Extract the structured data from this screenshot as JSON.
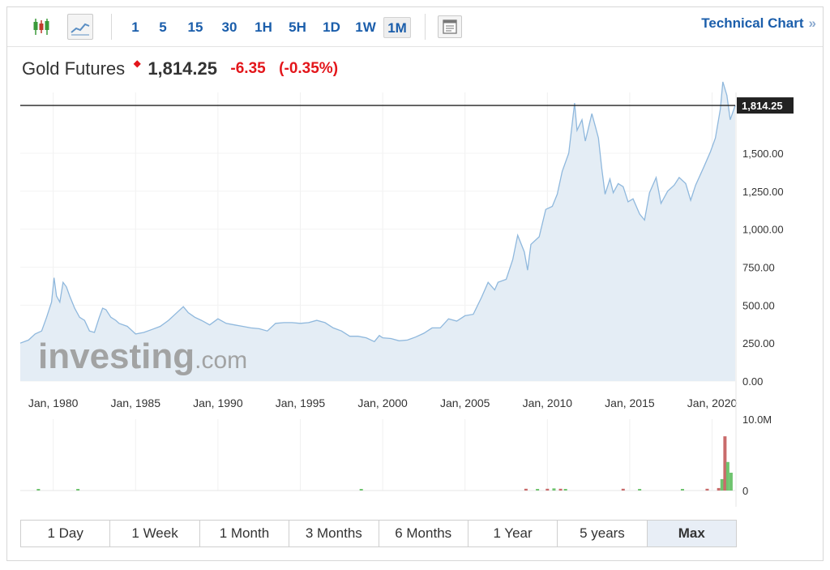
{
  "toolbar": {
    "chart_type_icons": [
      "candlestick-icon",
      "line-chart-icon"
    ],
    "intervals": [
      "1",
      "5",
      "15",
      "30",
      "1H",
      "5H",
      "1D",
      "1W",
      "1M"
    ],
    "active_interval": "1M",
    "settings_icon": "chart-settings-icon",
    "technical_chart_label": "Technical Chart",
    "technical_chart_chevron": "»"
  },
  "quote": {
    "name": "Gold Futures",
    "direction_icon": "down-arrow-icon",
    "price": "1,814.25",
    "change": "-6.35",
    "change_pct": "(-0.35%)"
  },
  "colors": {
    "accent": "#1b5eab",
    "negative": "#e3161b",
    "line": "#8fb8dd",
    "area": "#e4edf5",
    "volume_up": "#6fc46f",
    "volume_down": "#c96b6b"
  },
  "watermark": {
    "main": "investing",
    "suffix": ".com"
  },
  "range_buttons": [
    "1 Day",
    "1 Week",
    "1 Month",
    "3 Months",
    "6 Months",
    "1 Year",
    "5 years",
    "Max"
  ],
  "active_range": "Max",
  "chart_data": {
    "type": "area",
    "series": [
      {
        "values": [
          [
            1978.0,
            250
          ],
          [
            1978.5,
            270
          ],
          [
            1978.9,
            310
          ],
          [
            1979.3,
            330
          ],
          [
            1979.6,
            420
          ],
          [
            1979.9,
            520
          ],
          [
            1980.05,
            680
          ],
          [
            1980.2,
            560
          ],
          [
            1980.4,
            520
          ],
          [
            1980.6,
            650
          ],
          [
            1980.8,
            620
          ],
          [
            1981.0,
            560
          ],
          [
            1981.3,
            480
          ],
          [
            1981.6,
            420
          ],
          [
            1981.9,
            400
          ],
          [
            1982.2,
            330
          ],
          [
            1982.5,
            320
          ],
          [
            1982.8,
            420
          ],
          [
            1983.0,
            480
          ],
          [
            1983.2,
            470
          ],
          [
            1983.5,
            420
          ],
          [
            1983.8,
            400
          ],
          [
            1984.0,
            380
          ],
          [
            1984.5,
            360
          ],
          [
            1985.0,
            310
          ],
          [
            1985.5,
            320
          ],
          [
            1986.0,
            340
          ],
          [
            1986.5,
            360
          ],
          [
            1987.0,
            400
          ],
          [
            1987.5,
            450
          ],
          [
            1987.9,
            490
          ],
          [
            1988.2,
            450
          ],
          [
            1988.6,
            420
          ],
          [
            1989.0,
            400
          ],
          [
            1989.5,
            370
          ],
          [
            1990.0,
            410
          ],
          [
            1990.5,
            380
          ],
          [
            1991.0,
            370
          ],
          [
            1991.5,
            360
          ],
          [
            1992.0,
            350
          ],
          [
            1992.5,
            345
          ],
          [
            1993.0,
            330
          ],
          [
            1993.5,
            380
          ],
          [
            1994.0,
            385
          ],
          [
            1994.5,
            385
          ],
          [
            1995.0,
            380
          ],
          [
            1995.5,
            385
          ],
          [
            1996.0,
            400
          ],
          [
            1996.5,
            385
          ],
          [
            1997.0,
            350
          ],
          [
            1997.5,
            330
          ],
          [
            1998.0,
            295
          ],
          [
            1998.5,
            295
          ],
          [
            1999.0,
            285
          ],
          [
            1999.5,
            260
          ],
          [
            1999.8,
            300
          ],
          [
            2000.0,
            285
          ],
          [
            2000.5,
            280
          ],
          [
            2001.0,
            265
          ],
          [
            2001.5,
            270
          ],
          [
            2002.0,
            290
          ],
          [
            2002.5,
            315
          ],
          [
            2003.0,
            350
          ],
          [
            2003.5,
            350
          ],
          [
            2004.0,
            410
          ],
          [
            2004.5,
            395
          ],
          [
            2005.0,
            430
          ],
          [
            2005.5,
            440
          ],
          [
            2006.0,
            550
          ],
          [
            2006.4,
            650
          ],
          [
            2006.8,
            600
          ],
          [
            2007.0,
            650
          ],
          [
            2007.5,
            670
          ],
          [
            2007.9,
            800
          ],
          [
            2008.2,
            960
          ],
          [
            2008.6,
            850
          ],
          [
            2008.8,
            730
          ],
          [
            2009.0,
            900
          ],
          [
            2009.5,
            950
          ],
          [
            2009.9,
            1130
          ],
          [
            2010.3,
            1150
          ],
          [
            2010.6,
            1230
          ],
          [
            2010.9,
            1380
          ],
          [
            2011.3,
            1500
          ],
          [
            2011.65,
            1830
          ],
          [
            2011.8,
            1650
          ],
          [
            2012.1,
            1720
          ],
          [
            2012.3,
            1580
          ],
          [
            2012.7,
            1760
          ],
          [
            2012.9,
            1680
          ],
          [
            2013.1,
            1600
          ],
          [
            2013.3,
            1400
          ],
          [
            2013.5,
            1230
          ],
          [
            2013.8,
            1330
          ],
          [
            2014.0,
            1240
          ],
          [
            2014.3,
            1300
          ],
          [
            2014.6,
            1280
          ],
          [
            2014.9,
            1180
          ],
          [
            2015.2,
            1200
          ],
          [
            2015.6,
            1100
          ],
          [
            2015.9,
            1060
          ],
          [
            2016.2,
            1240
          ],
          [
            2016.6,
            1340
          ],
          [
            2016.9,
            1170
          ],
          [
            2017.3,
            1250
          ],
          [
            2017.7,
            1290
          ],
          [
            2018.0,
            1340
          ],
          [
            2018.4,
            1300
          ],
          [
            2018.7,
            1190
          ],
          [
            2019.0,
            1290
          ],
          [
            2019.5,
            1410
          ],
          [
            2019.9,
            1510
          ],
          [
            2020.2,
            1600
          ],
          [
            2020.5,
            1790
          ],
          [
            2020.65,
            1970
          ],
          [
            2020.9,
            1880
          ],
          [
            2021.1,
            1720
          ],
          [
            2021.4,
            1814.25
          ]
        ]
      }
    ],
    "last_value_label": "1,814.25",
    "ylim": [
      0,
      1900
    ],
    "y_ticks": [
      "1,500.00",
      "1,250.00",
      "1,000.00",
      "750.00",
      "500.00",
      "250.00",
      "0.00"
    ],
    "y_tick_values": [
      1500,
      1250,
      1000,
      750,
      500,
      250,
      0
    ],
    "x_ticks": [
      "Jan, 1980",
      "Jan, 1985",
      "Jan, 1990",
      "Jan, 1995",
      "Jan, 2000",
      "Jan, 2005",
      "Jan, 2010",
      "Jan, 2015",
      "Jan, 2020"
    ],
    "x_tick_values": [
      1980,
      1985,
      1990,
      1995,
      2000,
      2005,
      2010,
      2015,
      2020
    ],
    "xlim": [
      1978.0,
      2021.4
    ],
    "volume": {
      "y_ticks": [
        "10.0M",
        "0"
      ],
      "y_tick_values": [
        10000000,
        0
      ],
      "bars": [
        {
          "x": 1979.1,
          "v": 200000,
          "dir": "up"
        },
        {
          "x": 1981.5,
          "v": 200000,
          "dir": "up"
        },
        {
          "x": 1998.7,
          "v": 200000,
          "dir": "up"
        },
        {
          "x": 2008.7,
          "v": 250000,
          "dir": "down"
        },
        {
          "x": 2009.4,
          "v": 200000,
          "dir": "up"
        },
        {
          "x": 2010.0,
          "v": 250000,
          "dir": "down"
        },
        {
          "x": 2010.4,
          "v": 300000,
          "dir": "up"
        },
        {
          "x": 2010.8,
          "v": 250000,
          "dir": "down"
        },
        {
          "x": 2011.1,
          "v": 200000,
          "dir": "up"
        },
        {
          "x": 2014.6,
          "v": 250000,
          "dir": "down"
        },
        {
          "x": 2015.6,
          "v": 200000,
          "dir": "up"
        },
        {
          "x": 2018.2,
          "v": 200000,
          "dir": "up"
        },
        {
          "x": 2019.7,
          "v": 250000,
          "dir": "down"
        },
        {
          "x": 2020.4,
          "v": 350000,
          "dir": "down"
        },
        {
          "x": 2020.6,
          "v": 1600000,
          "dir": "up"
        },
        {
          "x": 2020.78,
          "v": 7600000,
          "dir": "down"
        },
        {
          "x": 2020.95,
          "v": 4000000,
          "dir": "up"
        },
        {
          "x": 2021.15,
          "v": 2500000,
          "dir": "up"
        }
      ]
    }
  }
}
